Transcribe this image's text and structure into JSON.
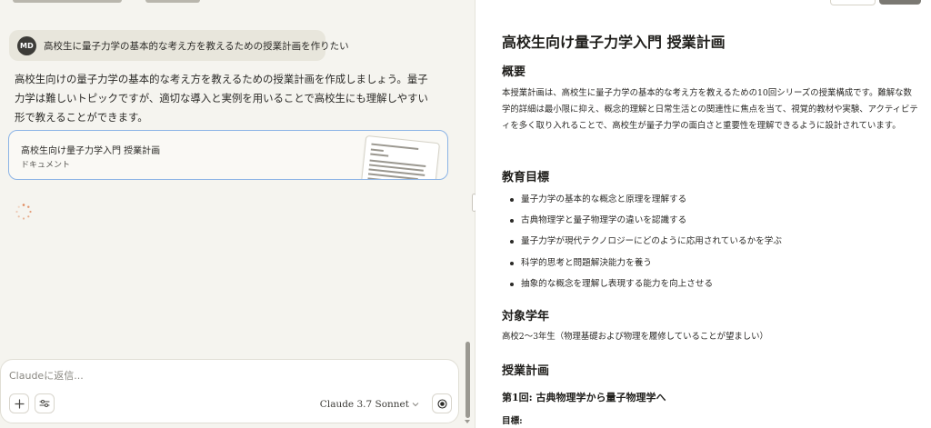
{
  "chat": {
    "user_message": {
      "avatar_initials": "MD",
      "text": "高校生に量子力学の基本的な考え方を教えるための授業計画を作りたい"
    },
    "assistant_message": "高校生向けの量子力学の基本的な考え方を教えるための授業計画を作成しましょう。量子力学は難しいトピックですが、適切な導入と実例を用いることで高校生にも理解しやすい形で教えることができます。",
    "artifact": {
      "title": "高校生向け量子力学入門 授業計画",
      "kind": "ドキュメント"
    },
    "composer": {
      "placeholder": "Claudeに返信...",
      "model": "Claude 3.7 Sonnet"
    }
  },
  "document": {
    "title": "高校生向け量子力学入門 授業計画",
    "overview": {
      "heading": "概要",
      "text": "本授業計画は、高校生に量子力学の基本的な考え方を教えるための10回シリーズの授業構成です。難解な数学的詳細は最小限に抑え、概念的理解と日常生活との関連性に焦点を当て、視覚的教材や実験、アクティビティを多く取り入れることで、高校生が量子力学の面白さと重要性を理解できるように設計されています。"
    },
    "goals": {
      "heading": "教育目標",
      "items": [
        "量子力学の基本的な概念と原理を理解する",
        "古典物理学と量子物理学の違いを認識する",
        "量子力学が現代テクノロジーにどのように応用されているかを学ぶ",
        "科学的思考と問題解決能力を養う",
        "抽象的な概念を理解し表現する能力を向上させる"
      ]
    },
    "target": {
      "heading": "対象学年",
      "text": "高校2〜3年生（物理基礎および物理を履修していることが望ましい）"
    },
    "plan": {
      "heading": "授業計画",
      "lesson1_title": "第1回: 古典物理学から量子物理学へ",
      "lesson1_goal_label": "目標:"
    }
  },
  "colors": {
    "chat_bg": "#f5f4ef",
    "user_bubble": "#e8e6dc",
    "artifact_border": "#8cb4e6",
    "doc_bg": "#ffffff"
  }
}
